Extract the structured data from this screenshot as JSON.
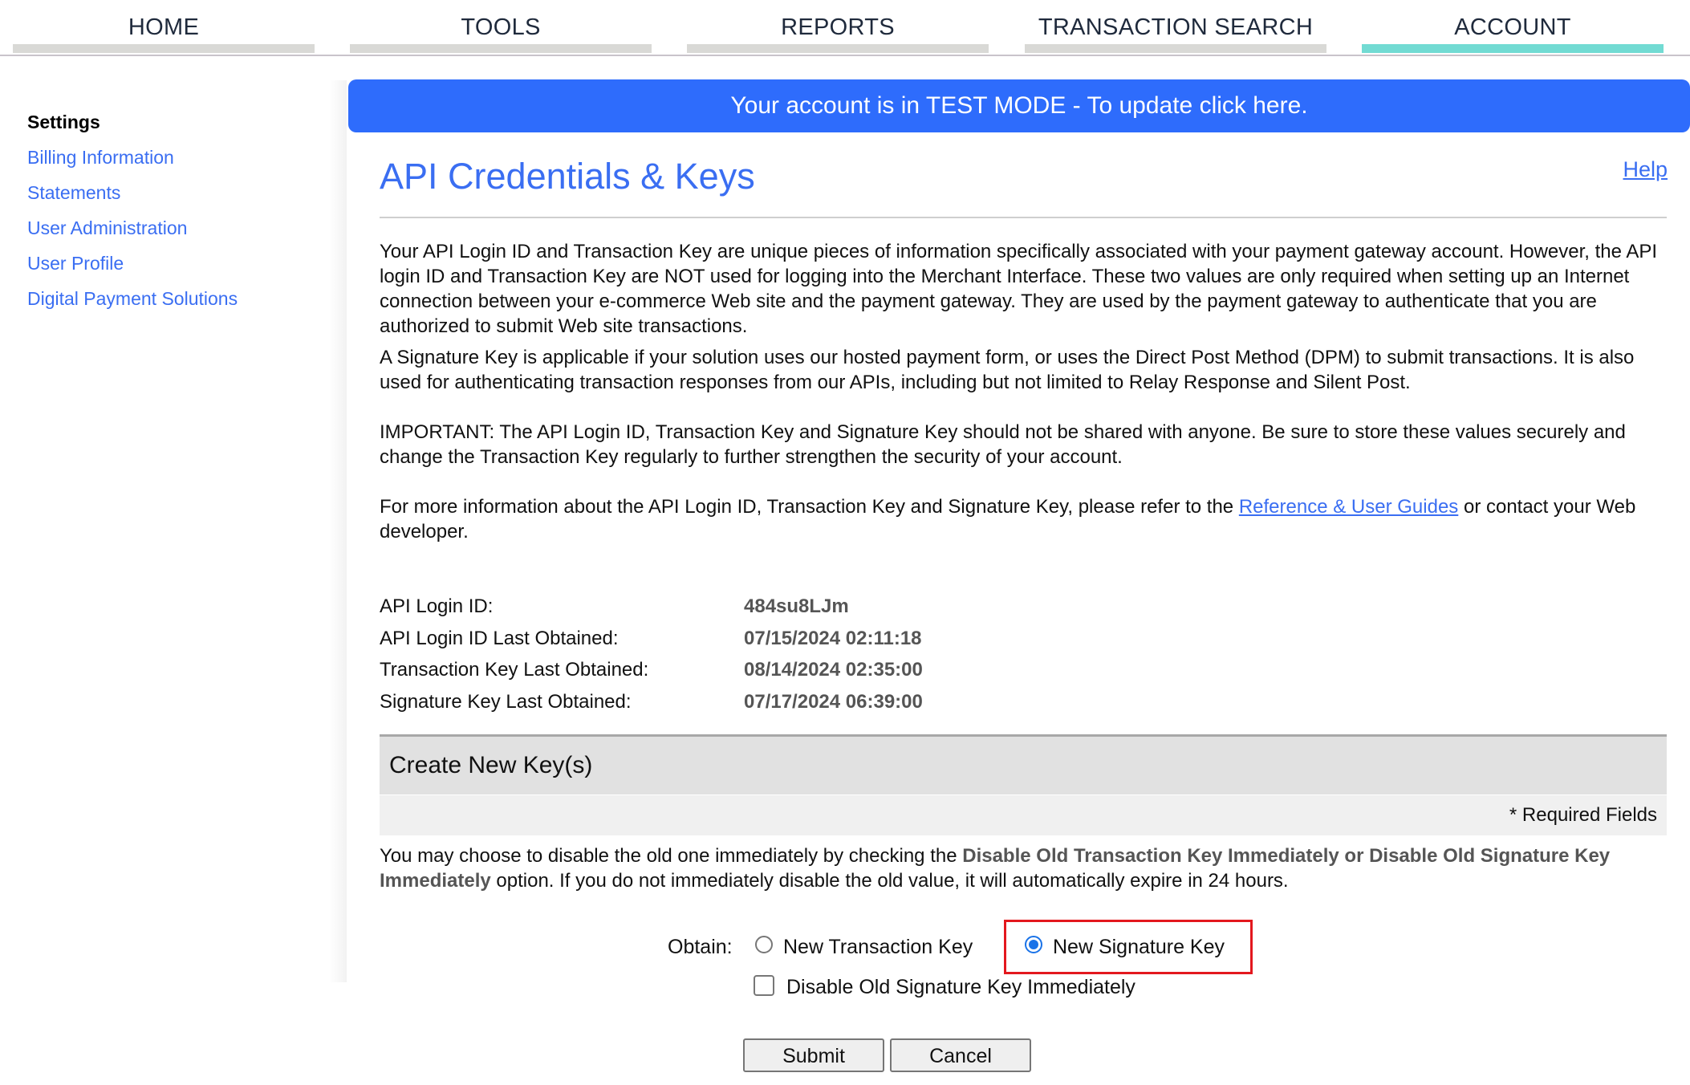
{
  "nav": {
    "tabs": [
      {
        "label": "HOME",
        "active": false
      },
      {
        "label": "TOOLS",
        "active": false
      },
      {
        "label": "REPORTS",
        "active": false
      },
      {
        "label": "TRANSACTION SEARCH",
        "active": false
      },
      {
        "label": "ACCOUNT",
        "active": true
      }
    ],
    "active_color": "#72dbd3"
  },
  "sidebar": {
    "heading": "Settings",
    "items": [
      {
        "label": "Billing Information"
      },
      {
        "label": "Statements"
      },
      {
        "label": "User Administration"
      },
      {
        "label": "User Profile"
      },
      {
        "label": "Digital Payment Solutions"
      }
    ]
  },
  "banner": {
    "text": "Your account is in TEST MODE - To update click here.",
    "color": "#2e6cfc"
  },
  "page": {
    "title": "API Credentials & Keys",
    "help_label": "Help"
  },
  "content": {
    "para1": "Your API Login ID and Transaction Key are unique pieces of information specifically associated with your payment gateway account. However, the API login ID and Transaction Key are NOT used for logging into the Merchant Interface. These two values are only required when setting up an Internet connection between your e-commerce Web site and the payment gateway. They are used by the payment gateway to authenticate that you are authorized to submit Web site transactions.",
    "para2": "A Signature Key is applicable if your solution uses our hosted payment form, or uses the Direct Post Method (DPM) to submit transactions. It is also used for authenticating transaction responses from our APIs, including but not limited to Relay Response and Silent Post.",
    "para3": "IMPORTANT: The API Login ID, Transaction Key and Signature Key should not be shared with anyone. Be sure to store these values securely and change the Transaction Key regularly to further strengthen the security of your account.",
    "para4_before": "For more information about the API Login ID, Transaction Key and Signature Key, please refer to the ",
    "para4_link": "Reference & User Guides",
    "para4_after": " or contact your Web developer."
  },
  "info": [
    {
      "label": "API Login ID:",
      "value": "484su8LJm"
    },
    {
      "label": "API Login ID Last Obtained:",
      "value": "07/15/2024 02:11:18"
    },
    {
      "label": "Transaction Key Last Obtained:",
      "value": "08/14/2024 02:35:00"
    },
    {
      "label": "Signature Key Last Obtained:",
      "value": "07/17/2024 06:39:00"
    }
  ],
  "create": {
    "heading": "Create New Key(s)",
    "required_note": "* Required Fields",
    "note_before": "You may choose to disable the old one immediately by checking the ",
    "note_highlight": "Disable Old Transaction Key Immediately or Disable Old Signature Key Immediately",
    "note_after": " option. If you do not immediately disable the old value, it will automatically expire in 24 hours.",
    "obtain_label": "Obtain:",
    "options": [
      {
        "label": "New Transaction Key",
        "checked": false
      },
      {
        "label": "New Signature Key",
        "checked": true
      }
    ],
    "checkbox_label": "Disable Old Signature Key Immediately",
    "checkbox_checked": false,
    "submit_label": "Submit",
    "cancel_label": "Cancel"
  }
}
